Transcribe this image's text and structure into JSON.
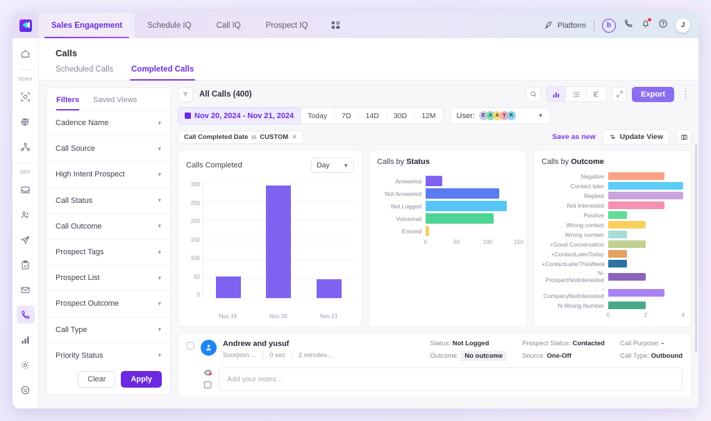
{
  "topbar": {
    "logo": "kixie-logo",
    "nav": [
      {
        "label": "Sales Engagement",
        "active": true
      },
      {
        "label": "Schedule IQ",
        "active": false
      },
      {
        "label": "Call IQ",
        "active": false
      },
      {
        "label": "Prospect IQ",
        "active": false
      }
    ],
    "apps_icon": "apps-grid-icon",
    "platform_label": "Platform",
    "power_dialer_label": "b",
    "avatar_initial": "J"
  },
  "rail": {
    "sections": [
      {
        "label": "",
        "items": [
          {
            "icon": "home-icon",
            "active": false
          }
        ]
      },
      {
        "label": "SDRx",
        "items": [
          {
            "icon": "target-scan-icon",
            "active": false
          },
          {
            "icon": "globe-plus-icon",
            "active": false
          },
          {
            "icon": "network-people-icon",
            "active": false
          }
        ]
      },
      {
        "label": "SEP",
        "items": [
          {
            "icon": "inbox-icon",
            "active": false
          },
          {
            "icon": "contacts-icon",
            "active": false
          },
          {
            "icon": "send-paperplane-icon",
            "active": false
          },
          {
            "icon": "clipboard-icon",
            "active": false
          },
          {
            "icon": "mail-icon",
            "active": false
          },
          {
            "icon": "phone-icon",
            "active": true
          },
          {
            "icon": "bar-chart-icon",
            "active": false
          },
          {
            "icon": "gear-icon",
            "active": false
          },
          {
            "icon": "smiley-icon",
            "active": false
          }
        ]
      }
    ]
  },
  "page": {
    "title": "Calls",
    "subtabs": [
      {
        "label": "Scheduled Calls",
        "active": false
      },
      {
        "label": "Completed Calls",
        "active": true
      }
    ]
  },
  "filters": {
    "tabs": [
      {
        "label": "Filters",
        "active": true
      },
      {
        "label": "Saved Views",
        "active": false
      }
    ],
    "items": [
      {
        "label": "Cadence Name"
      },
      {
        "label": "Call Source"
      },
      {
        "label": "High Intent Prospect"
      },
      {
        "label": "Call Status"
      },
      {
        "label": "Call Outcome"
      },
      {
        "label": "Prospect Tags"
      },
      {
        "label": "Prospect List"
      },
      {
        "label": "Prospect Outcome"
      },
      {
        "label": "Call Type"
      },
      {
        "label": "Priority Status"
      }
    ],
    "clear_label": "Clear",
    "apply_label": "Apply"
  },
  "toolbar": {
    "filter_icon": "funnel-icon",
    "all_calls_label": "All Calls (400)",
    "search_icon": "search-icon",
    "view_chart_icon": "bar-chart-view-icon",
    "view_list_icon": "list-view-icon",
    "view_split_icon": "split-view-icon",
    "expand_icon": "expand-icon",
    "export_label": "Export",
    "kebab_icon": "more-vertical-icon",
    "date_range": "Nov 20, 2024 - Nov 21, 2024",
    "presets": [
      "Today",
      "7D",
      "14D",
      "30D",
      "12M"
    ],
    "user_label": "User:",
    "user_avatars": [
      {
        "initial": "E",
        "color": "#cfc6f2"
      },
      {
        "initial": "A",
        "color": "#7fe0b0"
      },
      {
        "initial": "A",
        "color": "#f7d97a"
      },
      {
        "initial": "Y",
        "color": "#f7a8b8"
      },
      {
        "initial": "R",
        "color": "#86d9f0"
      }
    ],
    "chip": {
      "prefix": "Call Completed Date",
      "mid": "is",
      "value": "CUSTOM"
    },
    "save_as_new_label": "Save as new",
    "update_view_label": "Update View",
    "columns_icon": "columns-icon"
  },
  "chart_data": [
    {
      "type": "bar",
      "title": "Calls Completed",
      "granularity_selected": "Day",
      "categories": [
        "Nov 19",
        "Nov 20",
        "Nov 21"
      ],
      "values": [
        55,
        290,
        48
      ],
      "ylim": [
        0,
        300
      ],
      "yticks": [
        300,
        250,
        200,
        150,
        100,
        50,
        0
      ],
      "xlabel": "",
      "ylabel": "",
      "bar_color": "#7f62ef",
      "grid": true
    },
    {
      "type": "bar",
      "orientation": "horizontal",
      "title_prefix": "Calls by ",
      "title_bold": "Status",
      "categories": [
        "Answered",
        "Not Answered",
        "Not Logged",
        "Voicemail",
        "Errored"
      ],
      "values": [
        27,
        119,
        131,
        110,
        6
      ],
      "colors": [
        "#7f62ef",
        "#5b7cf0",
        "#57c8f5",
        "#4dd596",
        "#f8cf5a"
      ],
      "xlim": [
        0,
        150
      ],
      "xticks": [
        0,
        50,
        100,
        150
      ],
      "grid": true
    },
    {
      "type": "bar",
      "orientation": "horizontal",
      "title_prefix": "Calls by ",
      "title_bold": "Outcome",
      "categories": [
        "Negative",
        "Contact later",
        "Replied",
        "Not Interested",
        "Positive",
        "Wrong contact",
        "Wrong number",
        "+Good Conversation",
        "+ContactLaterToday",
        "+ContactLaterThisWeek",
        "N-ProspectNotInterested",
        "-CompanyNotInterested",
        "N-Wrong Number"
      ],
      "values": [
        3,
        4,
        4,
        3,
        1,
        2,
        1,
        2,
        1,
        1,
        2,
        3,
        2
      ],
      "colors": [
        "#f9a184",
        "#5ccdf5",
        "#c9a4dd",
        "#f590b3",
        "#5fdc96",
        "#fad05d",
        "#a5ddd8",
        "#c2d194",
        "#e3a261",
        "#2a74a3",
        "#8c63bb",
        "#a983f5",
        "#4aa888"
      ],
      "xlim": [
        0,
        4
      ],
      "xticks": [
        0,
        2,
        4
      ],
      "grid": true
    }
  ],
  "call_record": {
    "name": "Andrew and yusuf",
    "avatar_icon": "person-icon",
    "company": "Scorpion ...",
    "duration": "0 sec",
    "age": "2 minutes...",
    "status_label": "Status:",
    "status_value": "Not Logged",
    "outcome_label": "Outcome:",
    "outcome_value": "No outcome",
    "prospect_status_label": "Prospect Status:",
    "prospect_status_value": "Contacted",
    "source_label": "Source:",
    "source_value": "One-Off",
    "call_purpose_label": "Call Purpose:",
    "call_purpose_value": "-",
    "call_type_label": "Call Type:",
    "call_type_value": "Outbound",
    "notes_placeholder": "Add your notes...",
    "note_icon_1": "tag-icon",
    "note_icon_2": "sticky-note-icon"
  }
}
